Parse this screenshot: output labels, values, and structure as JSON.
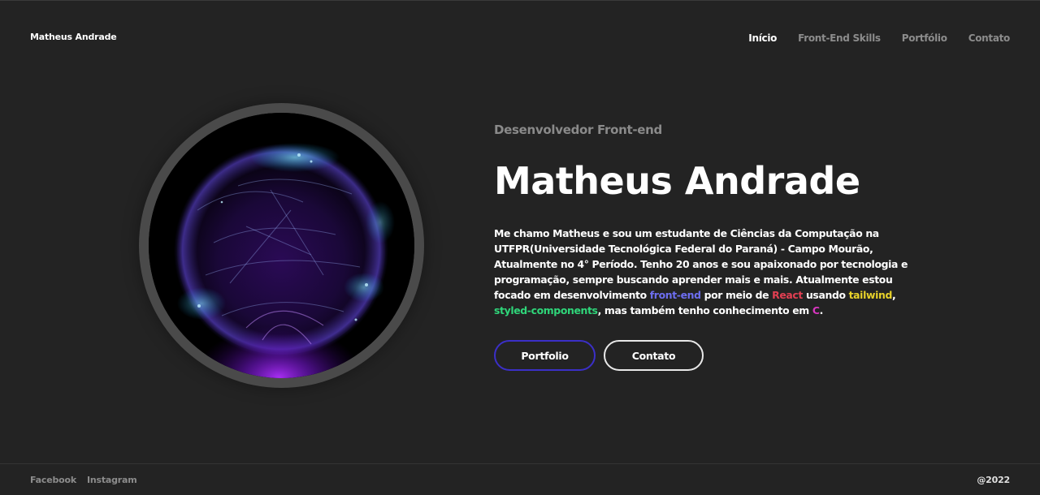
{
  "header": {
    "brand": "Matheus Andrade",
    "nav": [
      {
        "label": "Início",
        "active": true
      },
      {
        "label": "Front-End Skills",
        "active": false
      },
      {
        "label": "Portfólio",
        "active": false
      },
      {
        "label": "Contato",
        "active": false
      }
    ]
  },
  "hero": {
    "subtitle": "Desenvolvedor Front-end",
    "title": "Matheus Andrade",
    "about": {
      "p1": "Me chamo Matheus e sou um estudante de Ciências da Computação na UTFPR(Universidade Tecnológica Federal do Paraná) - Campo Mourão, Atualmente no 4° Período. Tenho 20 anos e sou apaixonado por tecnologia e programação, sempre buscando aprender mais e mais. Atualmente estou focado em desenvolvimento ",
      "front_end": "front-end",
      "p2": " por meio de ",
      "react": "React",
      "p3": " usando ",
      "tailwind": "tailwind",
      "p4": ", ",
      "styled": "styled-components",
      "p5": ", mas também tenho conhecimento em ",
      "c": "C",
      "p6": "."
    },
    "buttons": {
      "portfolio": "Portfolio",
      "contato": "Contato"
    }
  },
  "footer": {
    "links": [
      "Facebook",
      "Instagram"
    ],
    "copyright": "@2022"
  },
  "colors": {
    "background": "#232323",
    "highlight_front_end": "#6d6ef0",
    "highlight_react": "#e23f52",
    "highlight_tailwind": "#e8d22a",
    "highlight_styled": "#2fd67a",
    "highlight_c": "#d936c0",
    "portfolio_border": "#3b2fc7"
  },
  "icons": {
    "avatar": "glowing-particle-sphere"
  }
}
